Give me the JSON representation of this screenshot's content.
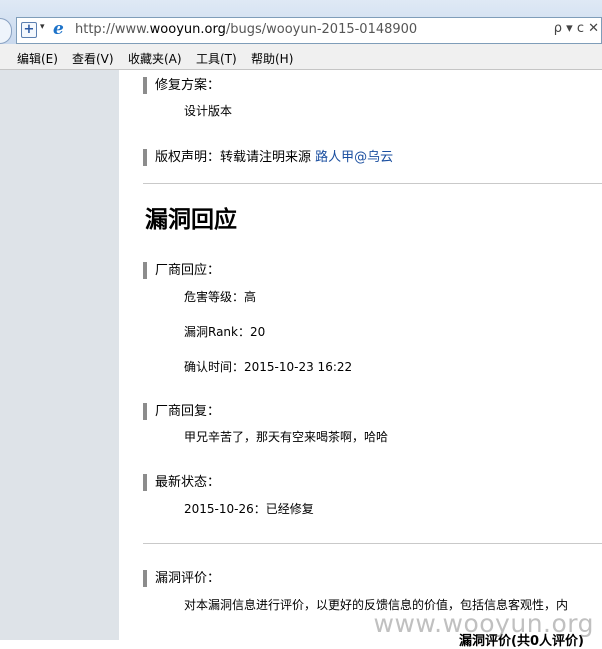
{
  "browser": {
    "url_prefix": "http://www.",
    "url_host": "wooyun.org",
    "url_path": "/bugs/wooyun-2015-0148900",
    "search_glyph": "ρ ▾ c ✕"
  },
  "menubar": {
    "items": [
      {
        "label": "编辑(E)"
      },
      {
        "label": "查看(V)"
      },
      {
        "label": "收藏夹(A)"
      },
      {
        "label": "工具(T)"
      },
      {
        "label": "帮助(H)"
      }
    ]
  },
  "page": {
    "fix": {
      "label": "修复方案：",
      "text": "设计版本"
    },
    "copyright": {
      "label": "版权声明：转载请注明来源",
      "author": "路人甲@乌云"
    },
    "response_heading": "漏洞回应",
    "vendor_response": {
      "label": "厂商回应：",
      "danger": "危害等级：高",
      "rank": "漏洞Rank：20",
      "confirm_time": "确认时间：2015-10-23 16:22"
    },
    "vendor_reply": {
      "label": "厂商回复：",
      "text": "甲兄辛苦了，那天有空来喝茶啊，哈哈"
    },
    "latest_status": {
      "label": "最新状态：",
      "text": "2015-10-26：已经修复"
    },
    "evaluation": {
      "label": "漏洞评价：",
      "text": "对本漏洞信息进行评价，以更好的反馈信息的价值，包括信息客观性，内"
    },
    "bottom_partial": "漏洞评价(共0人评价)"
  },
  "watermark": "www.wooyun.org"
}
